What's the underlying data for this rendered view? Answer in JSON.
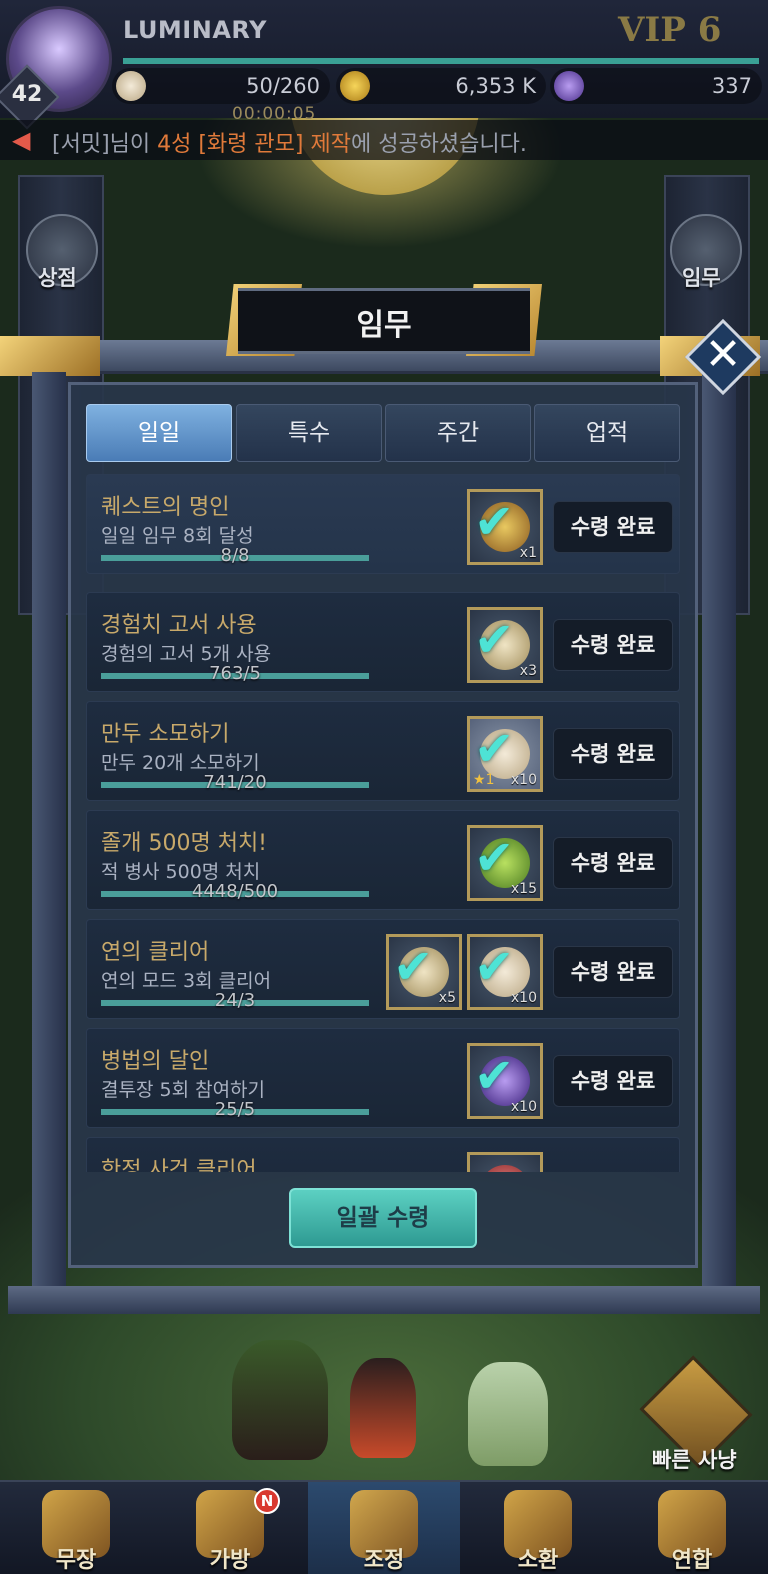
{
  "hud": {
    "player_name": "LUMINARY",
    "vip": "VIP 6",
    "level": "42",
    "timer": "00:00:05",
    "resources": [
      {
        "icon": "dumpling-icon",
        "value": "50/260"
      },
      {
        "icon": "gold-coin-icon",
        "value": "6,353 K"
      },
      {
        "icon": "purple-gem-icon",
        "value": "337"
      }
    ]
  },
  "notice": {
    "prefix": "[서밋]님이 ",
    "highlight": "4성 [화령 관모]",
    "middle": " 제작",
    "suffix": "에 성공하셨습니다."
  },
  "side": {
    "shop": "상점",
    "mission": "임무"
  },
  "modal": {
    "title": "임무",
    "tabs": [
      "일일",
      "특수",
      "주간",
      "업적"
    ],
    "active_tab": 0,
    "quests": [
      {
        "title": "퀘스트의 명인",
        "desc": "일일 임무 8회 달성",
        "progress": "8/8",
        "fill": 1.0,
        "rewards": [
          {
            "icon": "wand-icon",
            "count": "x1"
          }
        ],
        "claim": "수령 완료"
      },
      {
        "title": "경험치 고서 사용",
        "desc": "경험의 고서 5개 사용",
        "progress": "763/5",
        "fill": 1.0,
        "rewards": [
          {
            "icon": "scroll-icon",
            "count": "x3"
          }
        ],
        "claim": "수령 완료"
      },
      {
        "title": "만두 소모하기",
        "desc": "만두 20개 소모하기",
        "progress": "741/20",
        "fill": 1.0,
        "rewards": [
          {
            "icon": "dumpling-icon",
            "count": "x10",
            "star": "1"
          }
        ],
        "claim": "수령 완료"
      },
      {
        "title": "졸개 500명 처치!",
        "desc": "적 병사 500명 처치",
        "progress": "4448/500",
        "fill": 1.0,
        "rewards": [
          {
            "icon": "green-orb-icon",
            "count": "x15"
          }
        ],
        "claim": "수령 완료"
      },
      {
        "title": "연의 클리어",
        "desc": "연의 모드 3회 클리어",
        "progress": "24/3",
        "fill": 1.0,
        "rewards": [
          {
            "icon": "scroll-icon",
            "count": "x5"
          },
          {
            "icon": "dumpling-icon",
            "count": "x10"
          }
        ],
        "claim": "수령 완료"
      },
      {
        "title": "병법의 달인",
        "desc": "결투장 5회 참여하기",
        "progress": "25/5",
        "fill": 1.0,
        "rewards": [
          {
            "icon": "purple-orb-icon",
            "count": "x10"
          }
        ],
        "claim": "수령 완료"
      },
      {
        "title": "한정 사건 클리어",
        "desc": "",
        "progress": "",
        "fill": 1.0,
        "rewards": [
          {
            "icon": "red-item-icon",
            "count": ""
          }
        ],
        "claim": ""
      }
    ],
    "claim_all": "일괄 수령"
  },
  "quick_hunt": "빠른 사냥",
  "nav": [
    {
      "label": "무장",
      "icon": "general-icon",
      "badge": ""
    },
    {
      "label": "가방",
      "icon": "bag-icon",
      "badge": "N"
    },
    {
      "label": "조정",
      "icon": "court-icon",
      "badge": ""
    },
    {
      "label": "소환",
      "icon": "summon-icon",
      "badge": ""
    },
    {
      "label": "연합",
      "icon": "alliance-icon",
      "badge": ""
    }
  ],
  "colors": {
    "accent_teal": "#4ee3d5",
    "gold": "#c8a96a",
    "tab_active": "#6a9fd4",
    "claim_all": "#45b5aa"
  }
}
